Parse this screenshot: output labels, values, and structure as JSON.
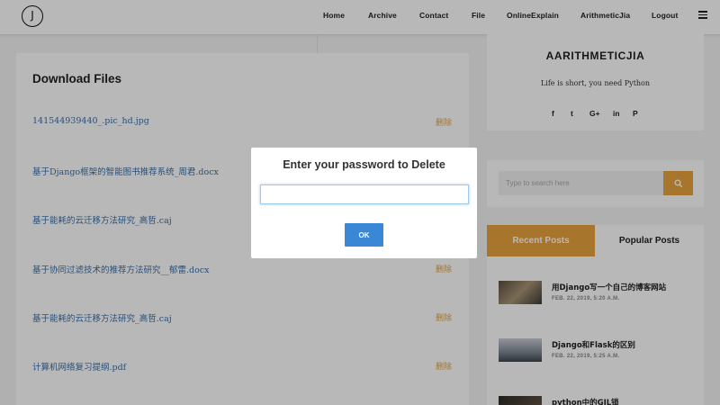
{
  "navbar": {
    "logo_letter": "J",
    "items": [
      "Home",
      "Archive",
      "Contact",
      "File",
      "OnlineExplain",
      "ArithmeticJia",
      "Logout"
    ],
    "menu_icon": "hamburger-icon"
  },
  "files": {
    "title": "Download Files",
    "delete_label": "删除",
    "rows": [
      "141544939440_.pic_hd.jpg",
      "基于Django框架的智能图书推荐系统_周君.docx",
      "基于能耗的云迁移方法研究_高哲.caj",
      "基于协同过滤技术的推荐方法研究__郁雷.docx",
      "基于能耗的云迁移方法研究_高哲.caj",
      "计算机网络复习提纲.pdf"
    ]
  },
  "about": {
    "title": "AARITHMETICJIA",
    "motto": "Life is short, you need Python",
    "social": [
      "f",
      "t",
      "G+",
      "in",
      "P"
    ]
  },
  "search": {
    "placeholder": "Type to search here",
    "button_icon": "search-icon"
  },
  "posts": {
    "tab_recent": "Recent Posts",
    "tab_popular": "Popular Posts",
    "items": [
      {
        "title": "用Django写一个自己的博客网站",
        "date": "FEB. 22, 2019, 5:20 A.M."
      },
      {
        "title": "Django和Flask的区别",
        "date": "FEB. 22, 2019, 5:25 A.M."
      },
      {
        "title": "python中的GIL锁",
        "date": ""
      }
    ]
  },
  "modal": {
    "title": "Enter your password to Delete",
    "input_value": "",
    "ok_label": "OK"
  },
  "colors": {
    "accent": "#e8a33d",
    "link": "#3a6ea8",
    "ok_button": "#3a87d6"
  }
}
